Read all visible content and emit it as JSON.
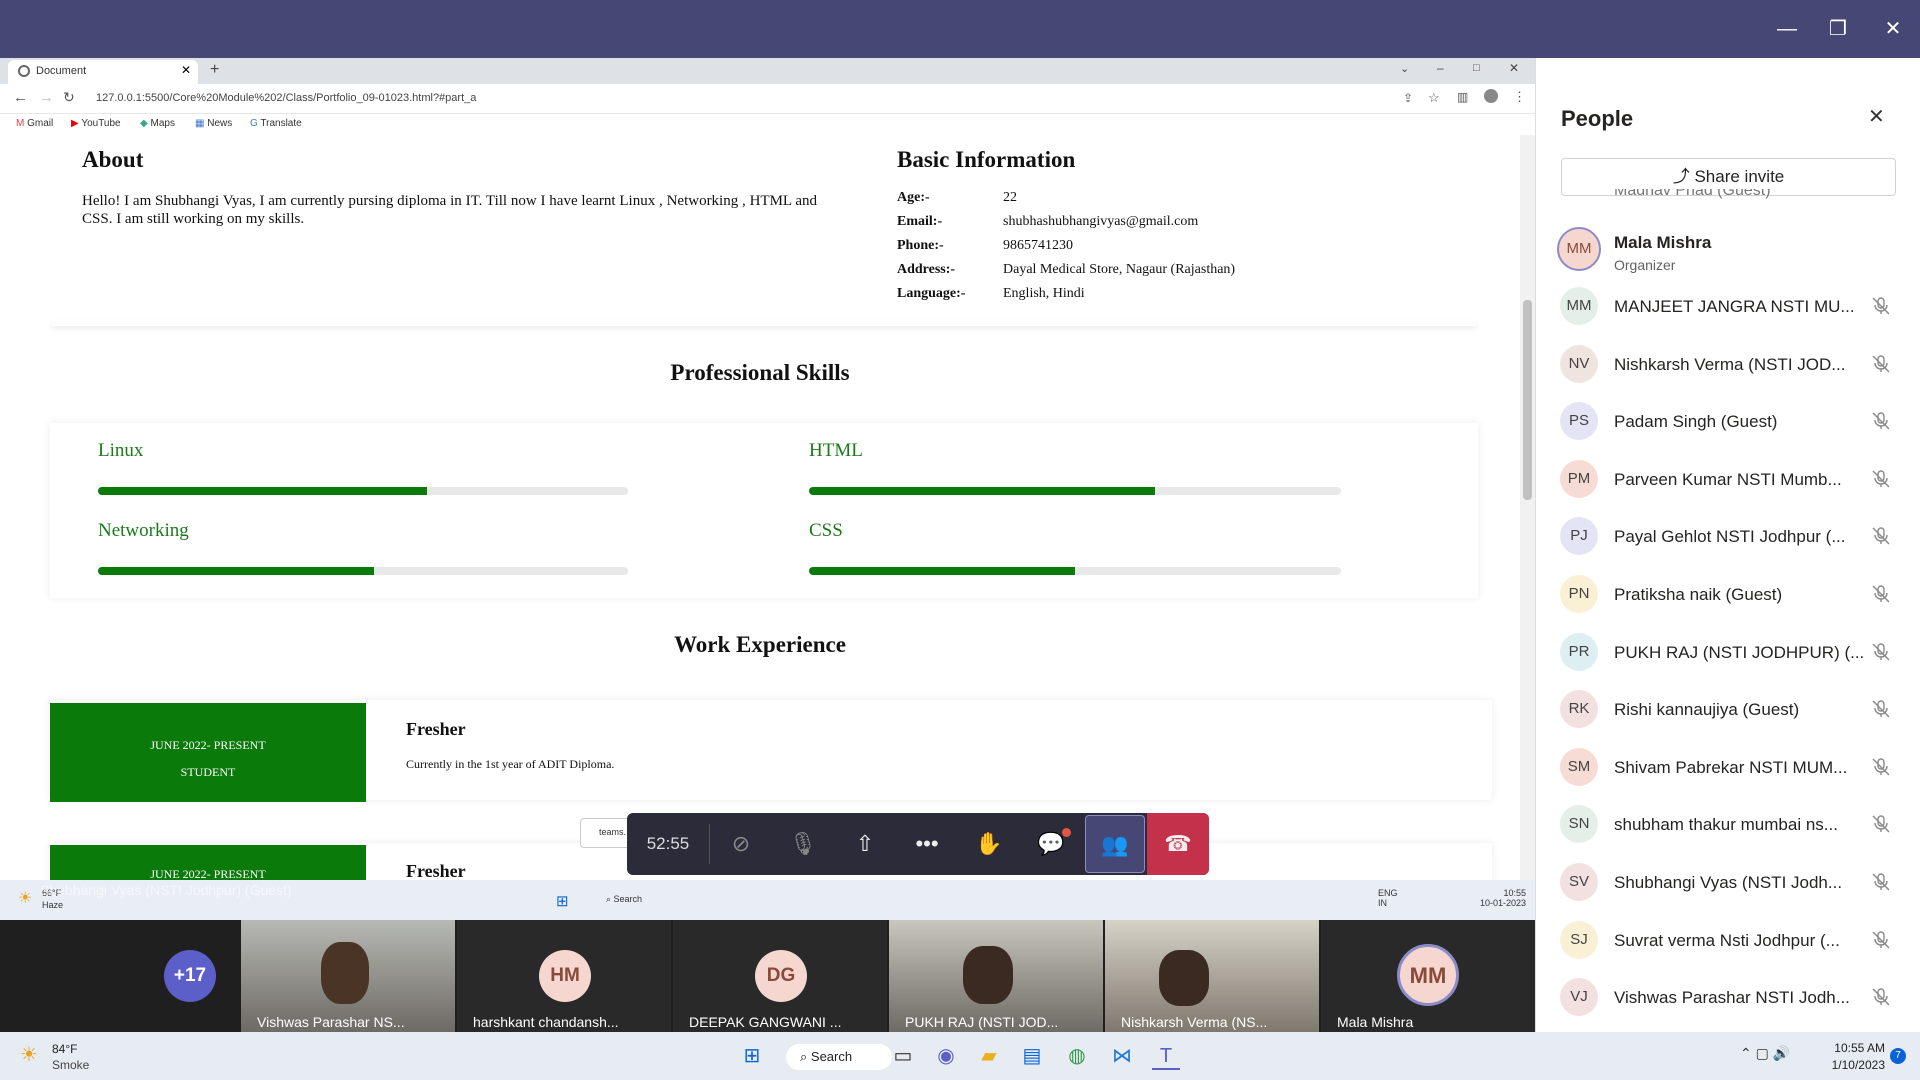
{
  "browser": {
    "tab_title": "Document",
    "url": "127.0.0.1:5500/Core%20Module%202/Class/Portfolio_09-01023.html?#part_a",
    "bookmarks": [
      "Gmail",
      "YouTube",
      "Maps",
      "News",
      "Translate"
    ]
  },
  "about": {
    "title": "About",
    "text": "Hello! I am Shubhangi Vyas, I am currently pursing diploma in IT. Till now I have learnt Linux , Networking , HTML and CSS. I am still working on my skills."
  },
  "basic": {
    "title": "Basic Information",
    "rows": [
      {
        "k": "Age:-",
        "v": "22"
      },
      {
        "k": "Email:-",
        "v": "shubhashubhangivyas@gmail.com"
      },
      {
        "k": "Phone:-",
        "v": "9865741230"
      },
      {
        "k": "Address:-",
        "v": "Dayal Medical Store, Nagaur (Rajasthan)"
      },
      {
        "k": "Language:-",
        "v": "English, Hindi"
      }
    ]
  },
  "skills": {
    "title": "Professional Skills",
    "items": [
      {
        "name": "Linux",
        "level": 0.62
      },
      {
        "name": "HTML",
        "level": 0.65
      },
      {
        "name": "Networking",
        "level": 0.52
      },
      {
        "name": "CSS",
        "level": 0.5
      }
    ]
  },
  "work": {
    "title": "Work Experience",
    "items": [
      {
        "date": "JUNE 2022- PRESENT",
        "role": "STUDENT",
        "title": "Fresher",
        "desc": "Currently in the 1st year of ADIT Diploma."
      },
      {
        "date": "JUNE 2022- PRESENT",
        "title": "Fresher"
      }
    ]
  },
  "call": {
    "timer": "52:55",
    "self_label": "Shubhangi Vyas (NSTI Jodhpur) (Guest)",
    "overflow": "+17"
  },
  "inner_taskbar": {
    "weather_temp": "66°F",
    "weather": "Haze",
    "search": "Search",
    "lang": "ENG",
    "region": "IN",
    "time": "10:55",
    "date": "10-01-2023",
    "teams_label": "teams."
  },
  "tiles": [
    {
      "name": "Vishwas Parashar NS...",
      "type": "video"
    },
    {
      "name": "harshkant chandansh...",
      "type": "avatar",
      "initials": "HM"
    },
    {
      "name": "DEEPAK GANGWANI ...",
      "type": "avatar",
      "initials": "DG"
    },
    {
      "name": "PUKH RAJ (NSTI JOD...",
      "type": "video"
    },
    {
      "name": "Nishkarsh Verma (NS...",
      "type": "video"
    },
    {
      "name": "Mala Mishra",
      "type": "avatar",
      "initials": "MM"
    }
  ],
  "people": {
    "title": "People",
    "share": "Share invite",
    "partial": "Madhav Phad (Guest)",
    "organizer": {
      "initials": "MM",
      "name": "Mala Mishra",
      "role": "Organizer"
    },
    "list": [
      {
        "initials": "MM",
        "name": "MANJEET JANGRA NSTI MU...",
        "color": "#e3efe8"
      },
      {
        "initials": "NV",
        "name": "Nishkarsh Verma (NSTI JOD...",
        "color": "#f0e4e0"
      },
      {
        "initials": "PS",
        "name": "Padam Singh (Guest)",
        "color": "#e5e4f5"
      },
      {
        "initials": "PM",
        "name": "Parveen Kumar NSTI Mumb...",
        "color": "#f7dcd5"
      },
      {
        "initials": "PJ",
        "name": "Payal Gehlot NSTI Jodhpur (...",
        "color": "#e5e4f5"
      },
      {
        "initials": "PN",
        "name": "Pratiksha naik (Guest)",
        "color": "#faf0d6"
      },
      {
        "initials": "PR",
        "name": "PUKH RAJ (NSTI JODHPUR) (...",
        "color": "#ddeff3"
      },
      {
        "initials": "RK",
        "name": "Rishi kannaujiya (Guest)",
        "color": "#f3e1e1"
      },
      {
        "initials": "SM",
        "name": "Shivam Pabrekar NSTI MUM...",
        "color": "#f7dcd5"
      },
      {
        "initials": "SN",
        "name": "shubham thakur mumbai ns...",
        "color": "#e3efe8"
      },
      {
        "initials": "SV",
        "name": "Shubhangi Vyas (NSTI Jodh...",
        "color": "#f3e1e1"
      },
      {
        "initials": "SJ",
        "name": "Suvrat verma Nsti Jodhpur (...",
        "color": "#faf0d6"
      },
      {
        "initials": "VJ",
        "name": "Vishwas Parashar NSTI Jodh...",
        "color": "#f3e1e1"
      }
    ]
  },
  "taskbar": {
    "temp": "84°F",
    "weather": "Smoke",
    "search": "Search",
    "time": "10:55 AM",
    "date": "1/10/2023",
    "badge": "7"
  }
}
